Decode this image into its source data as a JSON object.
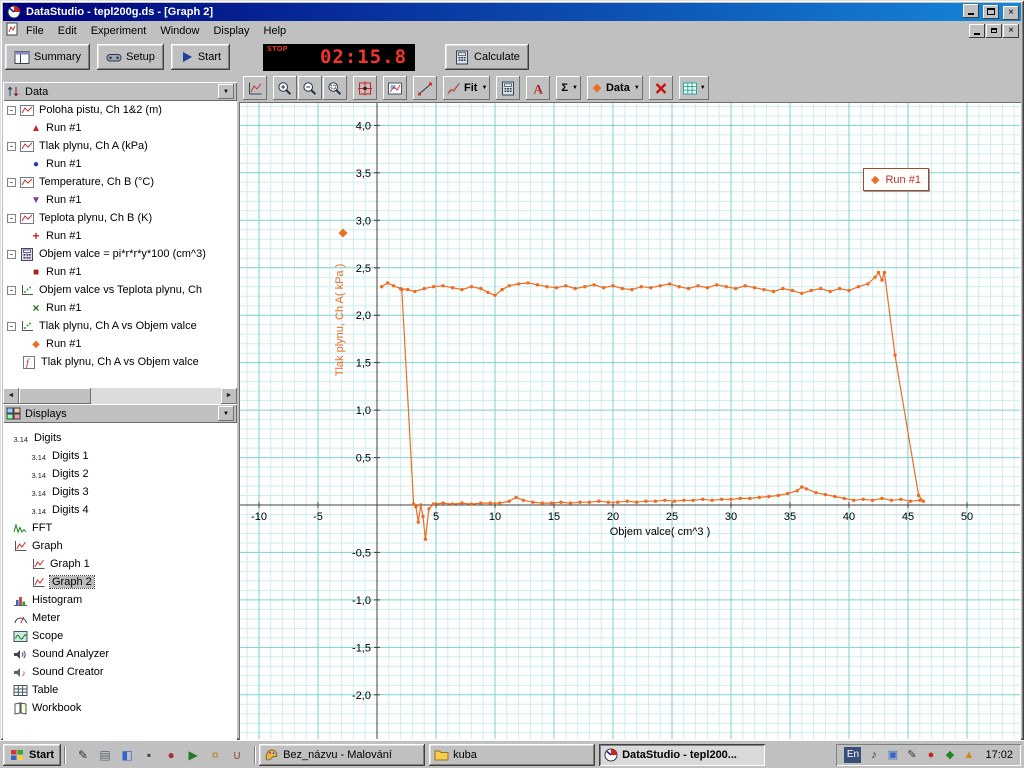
{
  "window": {
    "title": "DataStudio - tepl200g.ds - [Graph 2]",
    "menus": [
      "File",
      "Edit",
      "Experiment",
      "Window",
      "Display",
      "Help"
    ]
  },
  "main_toolbar": {
    "summary": "Summary",
    "setup": "Setup",
    "start": "Start",
    "timer_stop": "STOP",
    "timer_value": "02:15.8",
    "calculate": "Calculate"
  },
  "graph_toolbar": {
    "buttons": [
      {
        "name": "scale-to-fit-button",
        "icon": "scale-to-fit-icon"
      },
      {
        "name": "zoom-in-button",
        "icon": "zoom-in-icon",
        "gap": true
      },
      {
        "name": "zoom-out-button",
        "icon": "zoom-out-icon"
      },
      {
        "name": "zoom-select-button",
        "icon": "zoom-select-icon"
      },
      {
        "name": "smart-tool-button",
        "icon": "smart-tool-icon",
        "gap": true
      },
      {
        "name": "show-data-button",
        "icon": "show-data-icon",
        "gap": true
      },
      {
        "name": "slope-tool-button",
        "icon": "slope-tool-icon",
        "gap": true
      },
      {
        "name": "fit-menu-button",
        "icon": "fit-icon",
        "label": "Fit",
        "dropdown": true,
        "gap": true
      },
      {
        "name": "calculator-tool-button",
        "icon": "calculator-icon",
        "gap": true
      },
      {
        "name": "text-annotation-button",
        "icon": "text-tool-icon",
        "gap": true
      },
      {
        "name": "statistics-menu-button",
        "label": "Σ",
        "dropdown": true,
        "gap": true
      },
      {
        "name": "data-menu-button",
        "icon": "data-diamond-icon",
        "label": "Data",
        "dropdown": true,
        "gap": true
      },
      {
        "name": "remove-button",
        "icon": "delete-icon",
        "gap": true
      },
      {
        "name": "graph-settings-button",
        "icon": "grid-settings-icon",
        "dropdown": true,
        "gap": true
      }
    ]
  },
  "sidebar": {
    "data_header": "Data",
    "displays_header": "Displays",
    "data_tree": [
      {
        "label": "Poloha pistu, Ch 1&2 (m)",
        "icon": "measurement-icon",
        "runs": [
          {
            "label": "Run #1",
            "marker": "triangle-up",
            "color": "#cc2222"
          }
        ]
      },
      {
        "label": "Tlak plynu, Ch A (kPa)",
        "icon": "measurement-icon",
        "runs": [
          {
            "label": "Run #1",
            "marker": "circle",
            "color": "#2233cc"
          }
        ]
      },
      {
        "label": "Temperature, Ch B (°C)",
        "icon": "measurement-icon",
        "runs": [
          {
            "label": "Run #1",
            "marker": "triangle-down",
            "color": "#8833aa"
          }
        ]
      },
      {
        "label": "Teplota plynu, Ch B (K)",
        "icon": "measurement-icon",
        "runs": [
          {
            "label": "Run #1",
            "marker": "plus",
            "color": "#cc2222"
          }
        ]
      },
      {
        "label": "Objem valce = pi*r*r*y*100 (cm^3)",
        "icon": "calculation-icon",
        "runs": [
          {
            "label": "Run #1",
            "marker": "square",
            "color": "#aa2222"
          }
        ]
      },
      {
        "label": "Objem valce vs Teplota plynu, Ch",
        "icon": "xy-data-icon",
        "runs": [
          {
            "label": "Run #1",
            "marker": "x",
            "color": "#227722"
          }
        ]
      },
      {
        "label": "Tlak plynu, Ch A vs Objem valce",
        "icon": "xy-data-icon",
        "runs": [
          {
            "label": "Run #1",
            "marker": "diamond",
            "color": "#ee6d22"
          }
        ]
      },
      {
        "label": "Tlak plynu, Ch A vs Objem valce",
        "icon": "formula-icon",
        "expandable": false,
        "runs": []
      }
    ],
    "displays_tree": [
      {
        "label": "Digits",
        "icon": "digits-icon",
        "level": 1
      },
      {
        "label": "Digits 1",
        "icon": "digits-icon",
        "level": 2
      },
      {
        "label": "Digits 2",
        "icon": "digits-icon",
        "level": 2
      },
      {
        "label": "Digits 3",
        "icon": "digits-icon",
        "level": 2
      },
      {
        "label": "Digits 4",
        "icon": "digits-icon",
        "level": 2
      },
      {
        "label": "FFT",
        "icon": "fft-icon",
        "level": 1
      },
      {
        "label": "Graph",
        "icon": "graph-icon",
        "level": 1
      },
      {
        "label": "Graph 1",
        "icon": "graph-icon",
        "level": 2
      },
      {
        "label": "Graph 2",
        "icon": "graph-icon",
        "level": 2,
        "selected": true
      },
      {
        "label": "Histogram",
        "icon": "histogram-icon",
        "level": 1
      },
      {
        "label": "Meter",
        "icon": "meter-icon",
        "level": 1
      },
      {
        "label": "Scope",
        "icon": "scope-icon",
        "level": 1
      },
      {
        "label": "Sound Analyzer",
        "icon": "sound-analyzer-icon",
        "level": 1
      },
      {
        "label": "Sound Creator",
        "icon": "sound-creator-icon",
        "level": 1
      },
      {
        "label": "Table",
        "icon": "table-icon",
        "level": 1
      },
      {
        "label": "Workbook",
        "icon": "workbook-icon",
        "level": 1
      }
    ]
  },
  "chart_data": {
    "type": "line",
    "title": "",
    "xlabel": "Objem valce( cm^3 )",
    "ylabel": "Tlak plynu, Ch A( kPa )",
    "xlim": [
      -11.6,
      54.5
    ],
    "ylim": [
      -2.47,
      4.24
    ],
    "x_ticks": [
      -10,
      -5,
      5,
      10,
      15,
      20,
      25,
      30,
      35,
      40,
      45,
      50
    ],
    "y_ticks": [
      -2,
      -1.5,
      -1,
      -0.5,
      0.5,
      1,
      1.5,
      2,
      2.5,
      3,
      3.5,
      4
    ],
    "y_tick_labels": [
      "-2,0",
      "-1,5",
      "-1,0",
      "-0,5",
      "0,5",
      "1,0",
      "1,5",
      "2,0",
      "2,5",
      "3,0",
      "3,5",
      "4,0"
    ],
    "grid": {
      "minor_step_x": 1,
      "minor_step_y": 0.1,
      "major_step_x": 5,
      "major_step_y": 0.5,
      "minor_color": "#cdeeee",
      "major_color": "#7cd2d2"
    },
    "legend": {
      "label": "Run #1",
      "marker": "◆",
      "position": "top-right"
    },
    "series": [
      {
        "name": "Run #1",
        "color": "#ee6d22",
        "points": [
          [
            0.4,
            2.3
          ],
          [
            0.9,
            2.34
          ],
          [
            1.4,
            2.31
          ],
          [
            2,
            2.28
          ],
          [
            2.6,
            2.27
          ],
          [
            3.2,
            2.25
          ],
          [
            4,
            2.28
          ],
          [
            4.8,
            2.3
          ],
          [
            5.6,
            2.31
          ],
          [
            6.4,
            2.29
          ],
          [
            7.2,
            2.27
          ],
          [
            8,
            2.3
          ],
          [
            8.8,
            2.28
          ],
          [
            9.4,
            2.24
          ],
          [
            10,
            2.21
          ],
          [
            10.6,
            2.27
          ],
          [
            11.2,
            2.31
          ],
          [
            12,
            2.33
          ],
          [
            12.8,
            2.34
          ],
          [
            13.6,
            2.32
          ],
          [
            14.4,
            2.3
          ],
          [
            15.2,
            2.29
          ],
          [
            16,
            2.31
          ],
          [
            16.8,
            2.28
          ],
          [
            17.6,
            2.3
          ],
          [
            18.4,
            2.32
          ],
          [
            19.2,
            2.29
          ],
          [
            20,
            2.31
          ],
          [
            20.8,
            2.28
          ],
          [
            21.6,
            2.27
          ],
          [
            22.4,
            2.3
          ],
          [
            23.2,
            2.29
          ],
          [
            24,
            2.31
          ],
          [
            24.8,
            2.33
          ],
          [
            25.6,
            2.3
          ],
          [
            26.4,
            2.28
          ],
          [
            27.2,
            2.31
          ],
          [
            28,
            2.29
          ],
          [
            28.8,
            2.32
          ],
          [
            29.6,
            2.3
          ],
          [
            30.4,
            2.28
          ],
          [
            31.2,
            2.31
          ],
          [
            32,
            2.29
          ],
          [
            32.8,
            2.27
          ],
          [
            33.6,
            2.25
          ],
          [
            34.4,
            2.28
          ],
          [
            35.2,
            2.26
          ],
          [
            36,
            2.23
          ],
          [
            36.8,
            2.26
          ],
          [
            37.6,
            2.28
          ],
          [
            38.4,
            2.25
          ],
          [
            39.2,
            2.28
          ],
          [
            40,
            2.26
          ],
          [
            40.8,
            2.3
          ],
          [
            41.6,
            2.33
          ],
          [
            42.2,
            2.4
          ],
          [
            42.5,
            2.45
          ],
          [
            42.8,
            2.37
          ],
          [
            43,
            2.45
          ],
          [
            43.9,
            1.58
          ],
          [
            45.9,
            0.1
          ],
          [
            46.3,
            0.04
          ],
          [
            46,
            0.05
          ],
          [
            45.2,
            0.04
          ],
          [
            44.4,
            0.06
          ],
          [
            43.6,
            0.05
          ],
          [
            42.8,
            0.07
          ],
          [
            42,
            0.05
          ],
          [
            41.2,
            0.06
          ],
          [
            40.4,
            0.05
          ],
          [
            39.6,
            0.07
          ],
          [
            38.8,
            0.09
          ],
          [
            38,
            0.11
          ],
          [
            37.2,
            0.13
          ],
          [
            36.4,
            0.17
          ],
          [
            36,
            0.19
          ],
          [
            35.6,
            0.15
          ],
          [
            34.8,
            0.12
          ],
          [
            34,
            0.1
          ],
          [
            33.2,
            0.09
          ],
          [
            32.4,
            0.08
          ],
          [
            31.6,
            0.07
          ],
          [
            30.8,
            0.07
          ],
          [
            30,
            0.06
          ],
          [
            29.2,
            0.06
          ],
          [
            28.4,
            0.05
          ],
          [
            27.6,
            0.06
          ],
          [
            26.8,
            0.05
          ],
          [
            26,
            0.05
          ],
          [
            25.2,
            0.04
          ],
          [
            24.4,
            0.05
          ],
          [
            23.6,
            0.04
          ],
          [
            22.8,
            0.04
          ],
          [
            22,
            0.03
          ],
          [
            21.2,
            0.04
          ],
          [
            20.4,
            0.03
          ],
          [
            19.6,
            0.03
          ],
          [
            18.8,
            0.04
          ],
          [
            18,
            0.03
          ],
          [
            17.2,
            0.03
          ],
          [
            16.4,
            0.02
          ],
          [
            15.6,
            0.03
          ],
          [
            14.8,
            0.02
          ],
          [
            14,
            0.02
          ],
          [
            13.2,
            0.03
          ],
          [
            12.4,
            0.05
          ],
          [
            11.8,
            0.08
          ],
          [
            11.2,
            0.04
          ],
          [
            10.4,
            0.02
          ],
          [
            9.6,
            0.02
          ],
          [
            8.8,
            0.02
          ],
          [
            8,
            0.01
          ],
          [
            7.2,
            0.02
          ],
          [
            6.4,
            0.01
          ],
          [
            5.6,
            0.02
          ],
          [
            4.8,
            0.01
          ],
          [
            4.4,
            -0.04
          ],
          [
            4.1,
            -0.36
          ],
          [
            3.9,
            -0.12
          ],
          [
            3.7,
            0
          ],
          [
            3.5,
            -0.18
          ],
          [
            3.3,
            -0.02
          ],
          [
            3.1,
            0.01
          ],
          [
            2.1,
            2.27
          ]
        ]
      }
    ]
  },
  "taskbar": {
    "start_label": "Start",
    "quick_launch": [
      {
        "name": "pen-icon",
        "glyph": "✎",
        "color": "#223344"
      },
      {
        "name": "document-icon",
        "glyph": "▤",
        "color": "#556677"
      },
      {
        "name": "paint-tool-icon",
        "glyph": "◧",
        "color": "#3366cc"
      },
      {
        "name": "floppy-disk-icon",
        "glyph": "▪",
        "color": "#444444"
      },
      {
        "name": "globe-icon",
        "glyph": "●",
        "color": "#aa3333"
      },
      {
        "name": "media-player-icon",
        "glyph": "▶",
        "color": "#227722"
      },
      {
        "name": "key-icon",
        "glyph": "¤",
        "color": "#aa8800"
      },
      {
        "name": "coffee-cup-icon",
        "glyph": "∪",
        "color": "#885533"
      }
    ],
    "tasks": [
      {
        "label": "Bez_názvu - Malování",
        "icon": "paint-icon",
        "active": false
      },
      {
        "label": "kuba",
        "icon": "folder-icon",
        "active": false
      },
      {
        "label": "DataStudio - tepl200...",
        "icon": "datastudio-icon",
        "active": true
      }
    ],
    "tray_lang": "En",
    "tray_icons": [
      {
        "name": "volume-icon",
        "glyph": "♪",
        "color": "#223344"
      },
      {
        "name": "display-settings-icon",
        "glyph": "▣",
        "color": "#3366cc"
      },
      {
        "name": "tablet-pen-icon",
        "glyph": "✎",
        "color": "#333333"
      },
      {
        "name": "antivirus-icon",
        "glyph": "●",
        "color": "#cc2222"
      },
      {
        "name": "scheduler-icon",
        "glyph": "◆",
        "color": "#228822"
      },
      {
        "name": "messenger-icon",
        "glyph": "▲",
        "color": "#cc8822"
      }
    ],
    "tray_time": "17:02"
  }
}
